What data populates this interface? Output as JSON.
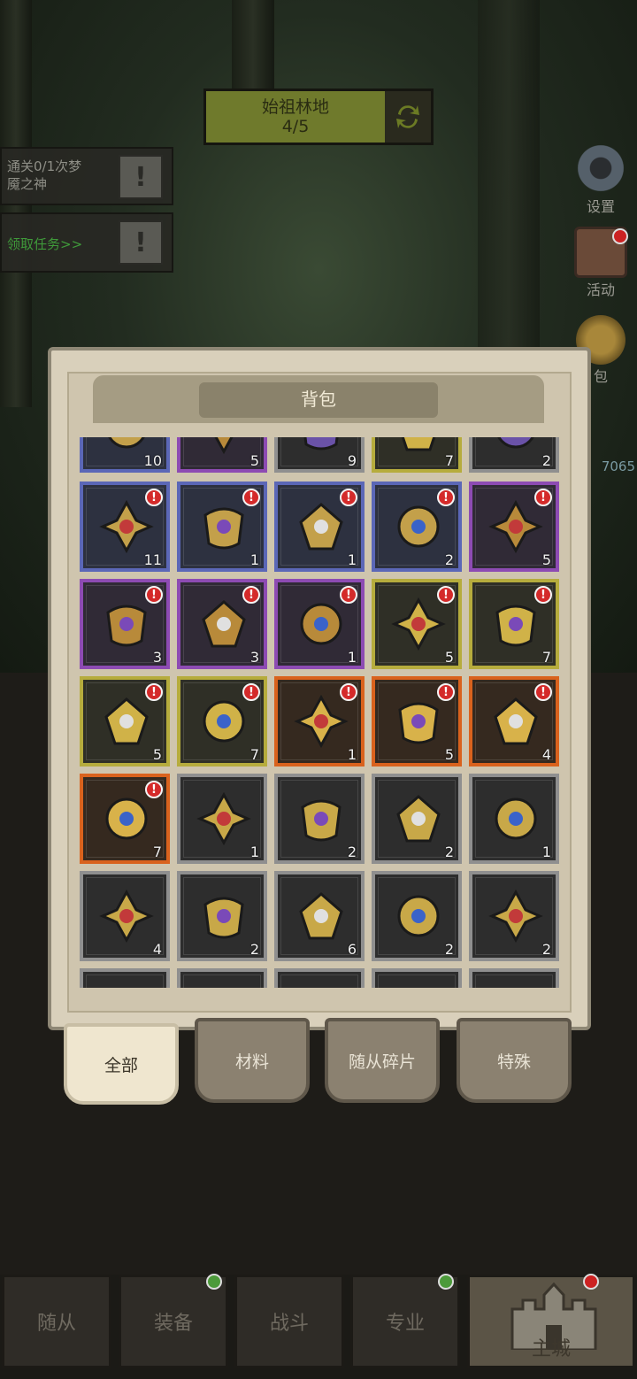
{
  "map": {
    "name": "始祖林地",
    "progress": "4/5"
  },
  "quests": [
    {
      "text": "通关0/1次梦\n魇之神",
      "color": "#8e8e86"
    },
    {
      "text": "领取任务>>",
      "color": "#3f9a3a"
    }
  ],
  "side": {
    "settings": "设置",
    "activity": "活动",
    "bag": "包"
  },
  "side_number": "7065",
  "panel": {
    "title": "背包"
  },
  "items": [
    {
      "rarity": "blue",
      "count": "10",
      "icon": "gem-item",
      "alert": false
    },
    {
      "rarity": "purple",
      "count": "5",
      "icon": "crystal-item",
      "alert": false
    },
    {
      "rarity": "gray-dark",
      "count": "9",
      "icon": "cloth-item",
      "alert": false
    },
    {
      "rarity": "gold",
      "count": "7",
      "icon": "horn-item",
      "alert": false
    },
    {
      "rarity": "gray-dark",
      "count": "2",
      "icon": "red-item",
      "alert": false
    },
    {
      "rarity": "blue",
      "count": "11",
      "icon": "sun-amulet-icon",
      "alert": true
    },
    {
      "rarity": "blue",
      "count": "1",
      "icon": "iron-ring-icon",
      "alert": true
    },
    {
      "rarity": "blue",
      "count": "1",
      "icon": "red-rune-icon",
      "alert": true
    },
    {
      "rarity": "blue",
      "count": "2",
      "icon": "lightning-orb-icon",
      "alert": true
    },
    {
      "rarity": "purple",
      "count": "5",
      "icon": "red-hood-icon",
      "alert": true
    },
    {
      "rarity": "purple",
      "count": "3",
      "icon": "war-horn-icon",
      "alert": true
    },
    {
      "rarity": "purple",
      "count": "3",
      "icon": "gear-bracer-icon",
      "alert": true
    },
    {
      "rarity": "purple",
      "count": "1",
      "icon": "drum-icon",
      "alert": true
    },
    {
      "rarity": "gold",
      "count": "5",
      "icon": "green-shard-icon",
      "alert": true
    },
    {
      "rarity": "gold",
      "count": "7",
      "icon": "pipe-icon",
      "alert": true
    },
    {
      "rarity": "gold",
      "count": "5",
      "icon": "ruby-crown-icon",
      "alert": true
    },
    {
      "rarity": "gold",
      "count": "7",
      "icon": "horned-helmet-icon",
      "alert": true
    },
    {
      "rarity": "orange",
      "count": "1",
      "icon": "blue-helmet-icon",
      "alert": true
    },
    {
      "rarity": "orange",
      "count": "5",
      "icon": "dagger-icon",
      "alert": true
    },
    {
      "rarity": "orange",
      "count": "4",
      "icon": "star-orb-icon",
      "alert": true
    },
    {
      "rarity": "orange",
      "count": "7",
      "icon": "gold-crown-icon",
      "alert": true
    },
    {
      "rarity": "gray",
      "count": "1",
      "icon": "hammer-icon",
      "alert": false
    },
    {
      "rarity": "gray",
      "count": "2",
      "icon": "diamond-emblem-icon",
      "alert": false
    },
    {
      "rarity": "gray",
      "count": "2",
      "icon": "shuriken-icon",
      "alert": false
    },
    {
      "rarity": "gray",
      "count": "1",
      "icon": "red-potion-icon",
      "alert": false
    },
    {
      "rarity": "gray",
      "count": "4",
      "icon": "purple-crest-icon",
      "alert": false
    },
    {
      "rarity": "gray",
      "count": "2",
      "icon": "winged-crest-icon",
      "alert": false
    },
    {
      "rarity": "gray",
      "count": "6",
      "icon": "gold-shield-icon",
      "alert": false
    },
    {
      "rarity": "gray",
      "count": "2",
      "icon": "lion-spears-icon",
      "alert": false
    },
    {
      "rarity": "gray",
      "count": "2",
      "icon": "sun-medal-icon",
      "alert": false
    },
    {
      "rarity": "gray",
      "count": "",
      "icon": "hidden-item",
      "alert": false
    },
    {
      "rarity": "gray",
      "count": "",
      "icon": "hidden-item",
      "alert": false
    },
    {
      "rarity": "gray",
      "count": "",
      "icon": "hidden-item",
      "alert": false
    },
    {
      "rarity": "gray",
      "count": "",
      "icon": "hidden-item",
      "alert": false
    },
    {
      "rarity": "gray",
      "count": "",
      "icon": "hidden-item",
      "alert": false
    }
  ],
  "tabs": [
    {
      "label": "全部",
      "active": true
    },
    {
      "label": "材料",
      "active": false
    },
    {
      "label": "随从碎片",
      "active": false
    },
    {
      "label": "特殊",
      "active": false
    }
  ],
  "nav": [
    {
      "label": "随从",
      "badge": false
    },
    {
      "label": "装备",
      "badge": true
    },
    {
      "label": "战斗",
      "badge": false
    },
    {
      "label": "专业",
      "badge": true
    },
    {
      "label": "主城",
      "badge": true
    }
  ]
}
